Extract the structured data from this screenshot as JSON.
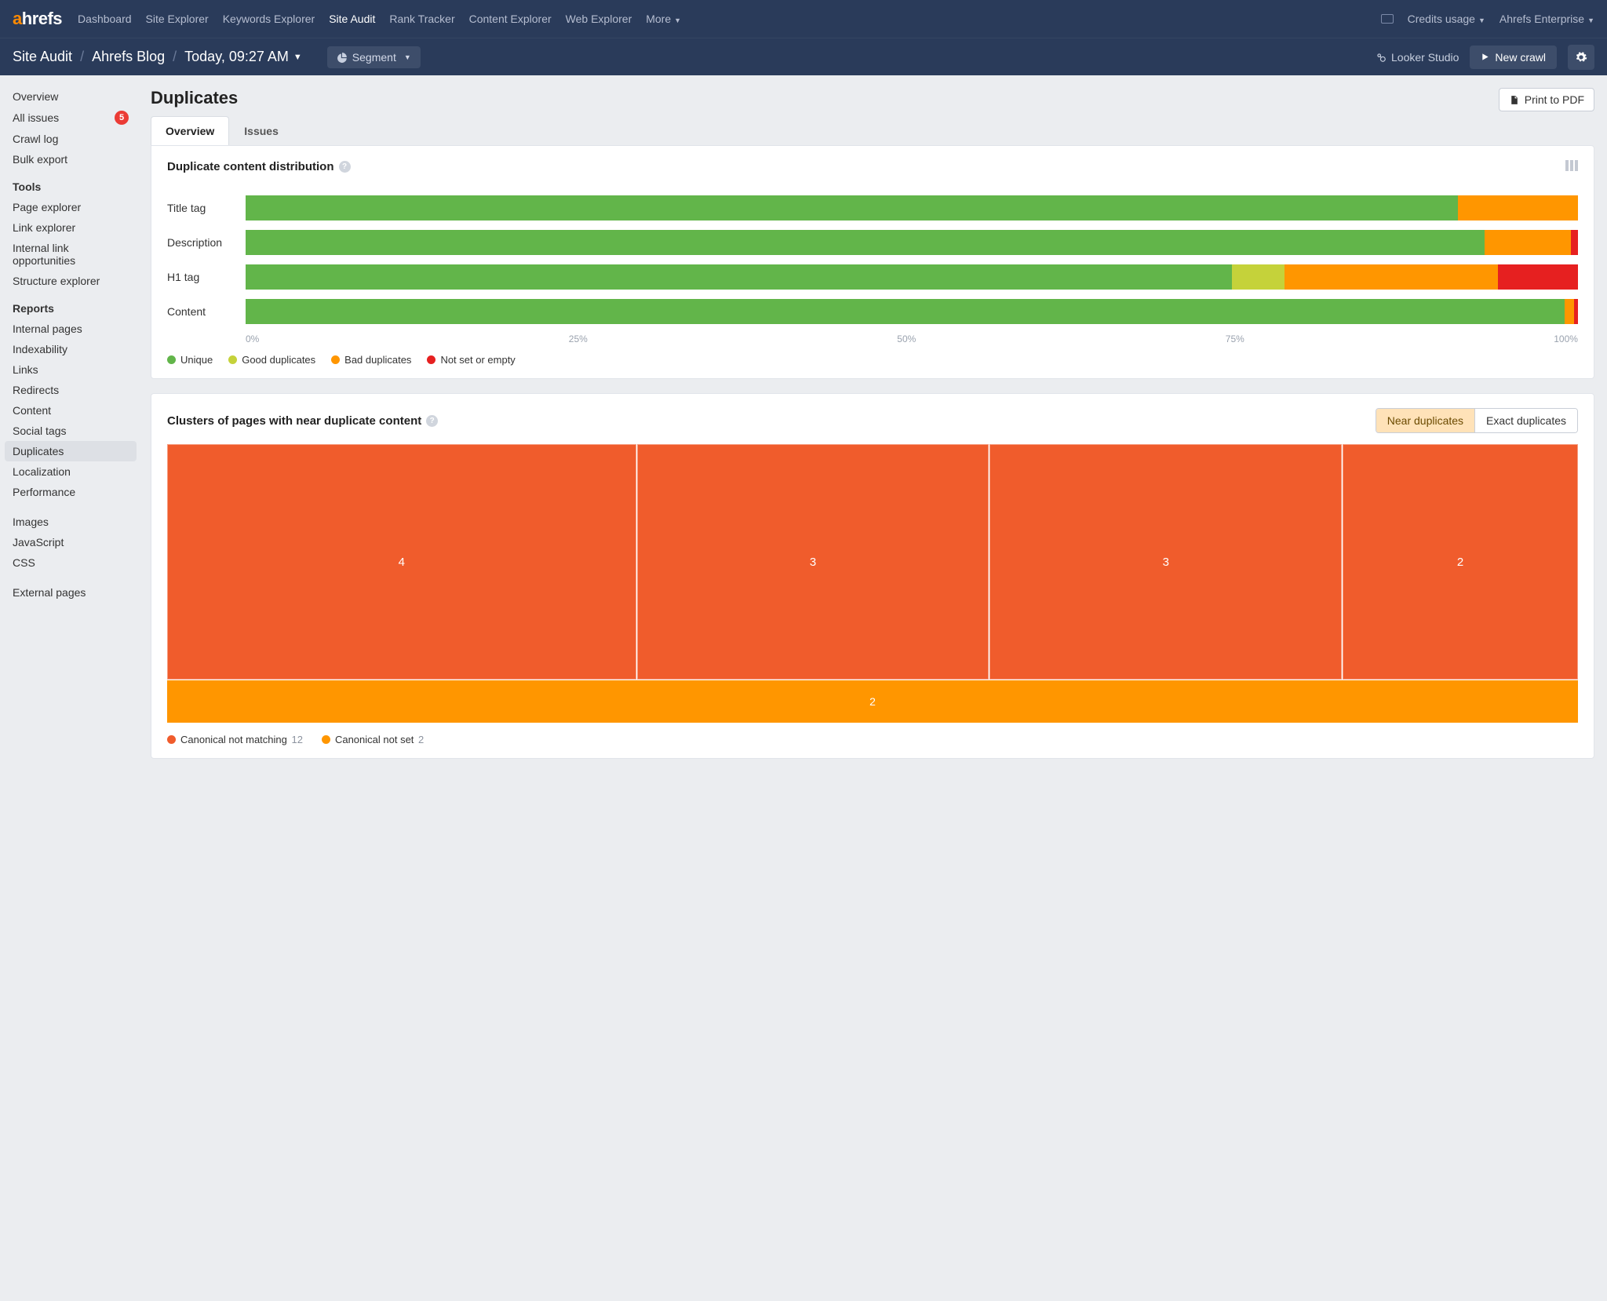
{
  "topnav": {
    "items": [
      "Dashboard",
      "Site Explorer",
      "Keywords Explorer",
      "Site Audit",
      "Rank Tracker",
      "Content Explorer",
      "Web Explorer",
      "More"
    ],
    "active": "Site Audit",
    "credits": "Credits usage",
    "account": "Ahrefs Enterprise"
  },
  "subheader": {
    "crumb1": "Site Audit",
    "crumb2": "Ahrefs Blog",
    "crawl_date": "Today, 09:27 AM",
    "segment": "Segment",
    "looker": "Looker Studio",
    "newcrawl": "New crawl"
  },
  "sidebar": {
    "top": [
      {
        "label": "Overview"
      },
      {
        "label": "All issues",
        "badge": "5"
      },
      {
        "label": "Crawl log"
      },
      {
        "label": "Bulk export"
      }
    ],
    "tools_heading": "Tools",
    "tools": [
      "Page explorer",
      "Link explorer",
      "Internal link opportunities",
      "Structure explorer"
    ],
    "reports_heading": "Reports",
    "reports": [
      "Internal pages",
      "Indexability",
      "Links",
      "Redirects",
      "Content",
      "Social tags",
      "Duplicates",
      "Localization",
      "Performance"
    ],
    "misc": [
      "Images",
      "JavaScript",
      "CSS"
    ],
    "external": "External pages"
  },
  "page": {
    "title": "Duplicates",
    "print": "Print to PDF",
    "tabs": [
      "Overview",
      "Issues"
    ]
  },
  "chart_data": [
    {
      "type": "bar",
      "orientation": "horizontal-stacked",
      "title": "Duplicate content distribution",
      "categories": [
        "Title tag",
        "Description",
        "H1 tag",
        "Content"
      ],
      "series": [
        {
          "name": "Unique",
          "color": "#62b54a",
          "values": [
            91,
            93,
            74,
            99
          ]
        },
        {
          "name": "Good duplicates",
          "color": "#c5d23a",
          "values": [
            0,
            0,
            4,
            0
          ]
        },
        {
          "name": "Bad duplicates",
          "color": "#ff9600",
          "values": [
            9,
            6.5,
            16,
            0.7
          ]
        },
        {
          "name": "Not set or empty",
          "color": "#e62020",
          "values": [
            0,
            0.5,
            6,
            0.3
          ]
        }
      ],
      "xlim": [
        0,
        100
      ],
      "xticks": [
        "0%",
        "25%",
        "50%",
        "75%",
        "100%"
      ],
      "legend": [
        "Unique",
        "Good duplicates",
        "Bad duplicates",
        "Not set or empty"
      ]
    },
    {
      "type": "treemap",
      "title": "Clusters of pages with near duplicate content",
      "toggle": {
        "options": [
          "Near duplicates",
          "Exact duplicates"
        ],
        "active": "Near duplicates"
      },
      "groups": [
        {
          "name": "Canonical not matching",
          "color": "#f05c2c",
          "total": 12,
          "cells": [
            4,
            3,
            3,
            2
          ]
        },
        {
          "name": "Canonical not set",
          "color": "#ff9600",
          "total": 2,
          "cells": [
            2
          ]
        }
      ]
    }
  ]
}
